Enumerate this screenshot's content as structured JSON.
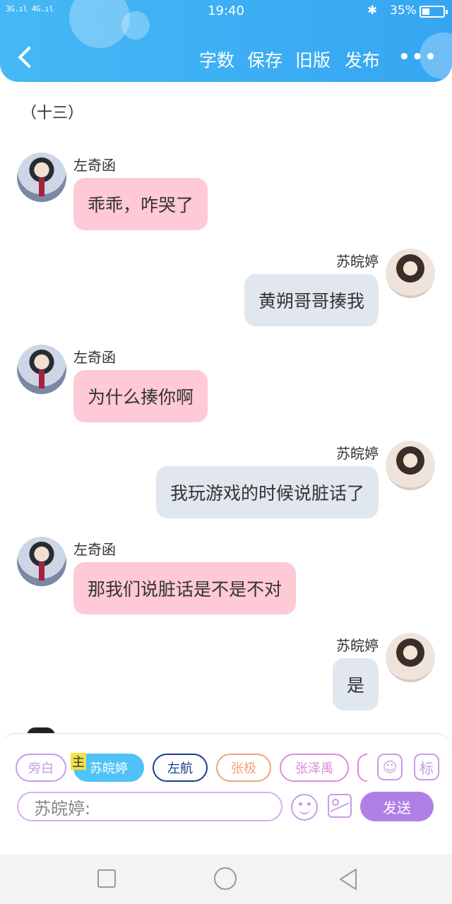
{
  "status_bar": {
    "signal": "3G.ıl 4G.ıl",
    "time": "19:40",
    "bluetooth": "✱",
    "battery": "35%",
    "battery_level": 0.35
  },
  "header": {
    "menu": [
      "字数",
      "保存",
      "旧版",
      "发布"
    ],
    "more": "•••",
    "colors": {
      "start": "#46b8f5",
      "end": "#35a6f2"
    }
  },
  "chapter_title": "（十三）",
  "messages": [
    {
      "side": "left",
      "name": "左奇函",
      "text": "乖乖，咋哭了",
      "avatar": "boy-avatar"
    },
    {
      "side": "right",
      "name": "苏皖婷",
      "text": "黄朔哥哥揍我",
      "avatar": "girl-avatar"
    },
    {
      "side": "left",
      "name": "左奇函",
      "text": "为什么揍你啊",
      "avatar": "boy-avatar"
    },
    {
      "side": "right",
      "name": "苏皖婷",
      "text": "我玩游戏的时候说脏话了",
      "avatar": "girl-avatar"
    },
    {
      "side": "left",
      "name": "左奇函",
      "text": "那我们说脏话是不是不对",
      "avatar": "boy-avatar"
    },
    {
      "side": "right",
      "name": "苏皖婷",
      "text": "是",
      "avatar": "girl-avatar"
    }
  ],
  "roles": [
    {
      "label": "旁白",
      "color": "#c89be8",
      "selected": false
    },
    {
      "label": "苏皖婷",
      "color": "#4fc3f7",
      "selected": true,
      "badge": "主"
    },
    {
      "label": "左航",
      "color": "#1a3d8f",
      "selected": false
    },
    {
      "label": "张极",
      "color": "#f0a37a",
      "selected": false
    },
    {
      "label": "张泽禹",
      "color": "#e08ad8",
      "selected": false
    }
  ],
  "role_icons": {
    "person": "person-icon",
    "tag": "标"
  },
  "input": {
    "placeholder": "苏皖婷:"
  },
  "send_label": "发送",
  "colors": {
    "pink_bubble": "#ffc9d5",
    "grey_bubble": "#e1e7ee",
    "accent": "#b07fe6"
  }
}
